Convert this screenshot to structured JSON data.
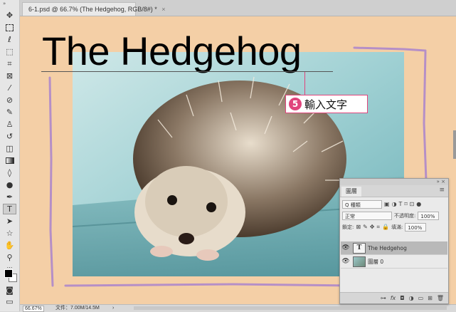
{
  "document_tab": {
    "title": "6-1.psd @ 66.7% (The Hedgehog, RGB/8#) *",
    "close": "×"
  },
  "canvas": {
    "headline": "The Hedgehog",
    "callout_number": "5",
    "callout_text": "輸入文字"
  },
  "status": {
    "zoom": "66.67%",
    "doc_size": "文件：7.00M/14.5M",
    "arrow": "›"
  },
  "layers_panel": {
    "tab_label": "圖層",
    "panel_controls": "» ×",
    "menu_icon": "≡",
    "filter_kind": "Q 種類",
    "blend_mode": "正常",
    "opacity_label": "不透明度:",
    "opacity_value": "100%",
    "lock_label": "鎖定:",
    "fill_label": "填滿:",
    "fill_value": "100%",
    "layers": [
      {
        "name": "The Hedgehog",
        "thumb": "T",
        "selected": true
      },
      {
        "name": "圖層 0",
        "thumb": "",
        "selected": false
      }
    ],
    "footer_icons": [
      "link-icon",
      "fx-icon",
      "mask-icon",
      "adjustment-icon",
      "folder-icon",
      "new-layer-icon",
      "trash-icon"
    ]
  },
  "colors": {
    "canvas_bg": "#f4cfa6",
    "callout_accent": "#e0447c",
    "stroke": "#b58fc7"
  }
}
